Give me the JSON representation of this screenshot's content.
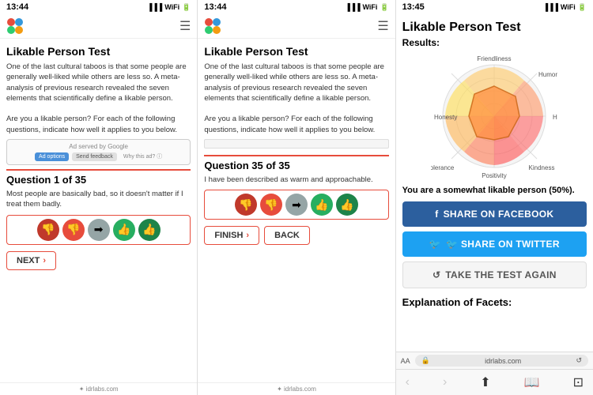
{
  "panels": [
    {
      "time": "13:44",
      "title": "Likable Person Test",
      "description": "One of the last cultural taboos is that some people are generally well-liked while others are less so. A meta-analysis of previous research revealed the seven elements that scientifically define a likable person.\n\nAre you a likable person? For each of the following questions, indicate how well it applies to you below.",
      "ad": {
        "label": "Ad served by Google",
        "btn1": "Ad options",
        "btn2": "Send feedback",
        "why": "Why this ad? ⓘ"
      },
      "question_header": "Question 1 of 35",
      "question_text": "Most people are basically bad, so it doesn't matter if I treat them badly.",
      "footer": "✦ idrlabs.com",
      "nav_action": "NEXT",
      "show_back": false
    },
    {
      "time": "13:44",
      "title": "Likable Person Test",
      "description": "One of the last cultural taboos is that some people are generally well-liked while others are less so. A meta-analysis of previous research revealed the seven elements that scientifically define a likable person.\n\nAre you a likable person? For each of the following questions, indicate how well it applies to you below.",
      "question_header": "Question 35 of 35",
      "question_text": "I have been described as warm and approachable.",
      "footer": "✦ idrlabs.com",
      "nav_action": "FINISH",
      "show_back": true
    },
    {
      "time": "13:45",
      "title": "Likable Person Test",
      "results_label": "Results:",
      "result_text": "You are a somewhat likable person (50%).",
      "share_facebook": "f  SHARE ON FACEBOOK",
      "share_twitter": "🐦  SHARE ON TWITTER",
      "retake": "↺  TAKE THE TEST AGAIN",
      "explanation_title": "Explanation of Facets:",
      "browser_aa": "AA",
      "browser_url": "idrlabs.com",
      "radar": {
        "labels": [
          "Friendliness",
          "Humor",
          "Happiness",
          "Kindness",
          "Positivity",
          "Tolerance",
          "Honesty"
        ],
        "values": [
          0.5,
          0.6,
          0.55,
          0.65,
          0.7,
          0.5,
          0.6
        ]
      }
    }
  ]
}
